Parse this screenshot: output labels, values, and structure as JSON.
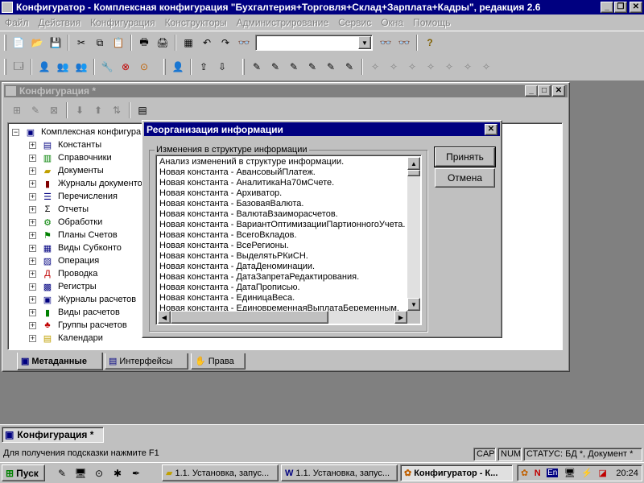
{
  "app": {
    "title": "Конфигуратор - Комплексная конфигурация \"Бухгалтерия+Торговля+Склад+Зарплата+Кадры\", редакция 2.6"
  },
  "menu": [
    "Файл",
    "Действия",
    "Конфигурация",
    "Конструкторы",
    "Администрирование",
    "Сервис",
    "Окна",
    "Помощь"
  ],
  "window": {
    "title": "Конфигурация *"
  },
  "tree": {
    "root": "Комплексная конфигура",
    "items": [
      "Константы",
      "Справочники",
      "Документы",
      "Журналы документо",
      "Перечисления",
      "Отчеты",
      "Обработки",
      "Планы Счетов",
      "Виды Субконто",
      "Операция",
      "Проводка",
      "Регистры",
      "Журналы расчетов",
      "Виды расчетов",
      "Группы расчетов",
      "Календари"
    ]
  },
  "tabs": [
    "Метаданные",
    "Интерфейсы",
    "Права"
  ],
  "dialog": {
    "title": "Реорганизация информации",
    "group": "Изменения в структуре информации",
    "ok": "Принять",
    "cancel": "Отмена",
    "lines": [
      "Анализ изменений в структуре информации.",
      "Новая константа - АвансовыйПлатеж.",
      "Новая константа - АналитикаНа70мСчете.",
      "Новая константа - Архиватор.",
      "Новая константа - БазоваяВалюта.",
      "Новая константа - ВалютаВзаиморасчетов.",
      "Новая константа - ВариантОптимизацииПартионногоУчета.",
      "Новая константа - ВсегоВкладов.",
      "Новая константа - ВсеРегионы.",
      "Новая константа - ВыделятьРКиСН.",
      "Новая константа - ДатаДеноминации.",
      "Новая константа - ДатаЗапретаРедактирования.",
      "Новая константа - ДатаПрописью.",
      "Новая константа - ЕдиницаВеса.",
      "Новая константа - ЕдиновременнаяВыплатаБеременным."
    ]
  },
  "mdi_tab": "Конфигурация *",
  "status": {
    "hint": "Для получения подсказки нажмите F1",
    "cap": "CAP",
    "num": "NUM",
    "state": "СТАТУС: БД *, Документ *"
  },
  "taskbar": {
    "start": "Пуск",
    "tasks": [
      "1.1. Установка, запус...",
      "1.1. Установка, запус...",
      "Конфигуратор - К..."
    ],
    "clock": "20:24",
    "lang": "En"
  }
}
